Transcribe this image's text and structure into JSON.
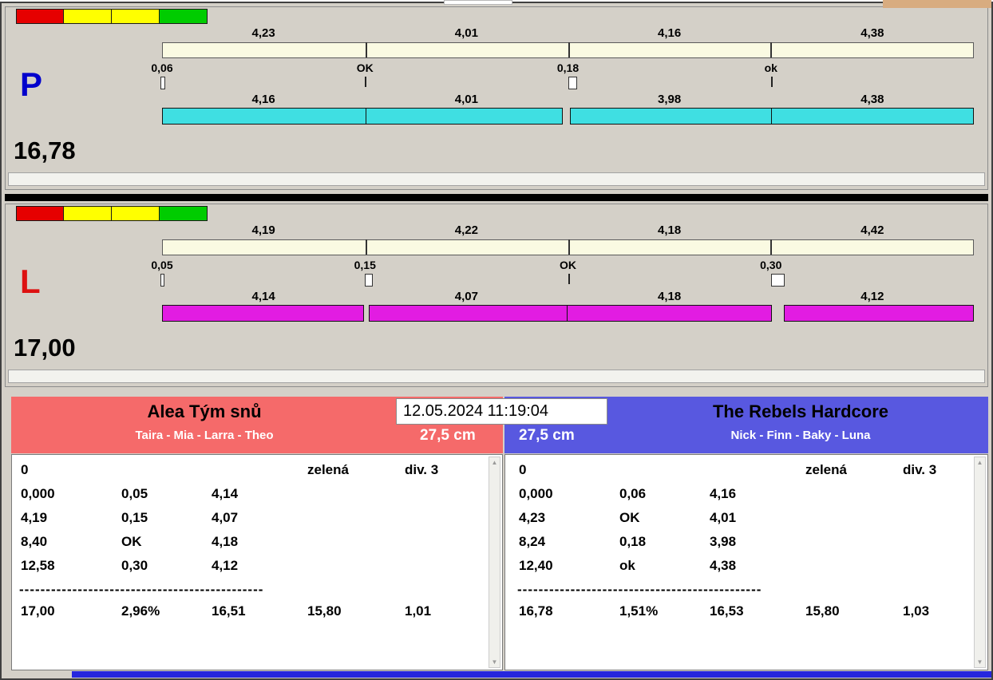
{
  "colors": {
    "window_bg": "#d4d0c8",
    "cream_bar": "#fafae2",
    "cyan_bar": "#3fdfe2",
    "magenta_bar": "#e21ce2",
    "traffic_red": "#e60000",
    "traffic_yellow": "#ffff00",
    "traffic_green": "#00cc00",
    "p_label": "#0000cc",
    "l_label": "#dd1111",
    "team_left_header": "#f56a6a",
    "team_right_header": "#5858e0",
    "bottom_bar": "#2626dd",
    "corner_fragment": "#d8ac80"
  },
  "panel_p": {
    "label": "P",
    "total": "16,78",
    "top_segments": [
      "4,23",
      "4,01",
      "4,16",
      "4,38"
    ],
    "markers": [
      "0,06",
      "OK",
      "0,18",
      "ok"
    ],
    "bottom_segments": [
      "4,16",
      "4,01",
      "3,98",
      "4,38"
    ]
  },
  "panel_l": {
    "label": "L",
    "total": "17,00",
    "top_segments": [
      "4,19",
      "4,22",
      "4,18",
      "4,42"
    ],
    "markers": [
      "0,05",
      "0,15",
      "OK",
      "0,30"
    ],
    "bottom_segments": [
      "4,14",
      "4,07",
      "4,18",
      "4,12"
    ]
  },
  "datetime": "12.05.2024 11:19:04",
  "teams": {
    "left": {
      "name": "Alea Tým snů",
      "members": "Taira - Mia - Larra - Theo",
      "distance": "27,5 cm",
      "rows": [
        [
          "0",
          "",
          "",
          "zelená",
          "div. 3"
        ],
        [
          "0,000",
          "0,05",
          "4,14",
          "",
          ""
        ],
        [
          "4,19",
          "0,15",
          "4,07",
          "",
          ""
        ],
        [
          "8,40",
          "OK",
          "4,18",
          "",
          ""
        ],
        [
          "12,58",
          "0,30",
          "4,12",
          "",
          ""
        ]
      ],
      "separator": "----------------------------------------------",
      "summary": [
        "17,00",
        "2,96%",
        "16,51",
        "15,80",
        "1,01"
      ]
    },
    "right": {
      "name": "The Rebels Hardcore",
      "members": "Nick - Finn - Baky - Luna",
      "distance": "27,5 cm",
      "rows": [
        [
          "0",
          "",
          "",
          "zelená",
          "div. 3"
        ],
        [
          "0,000",
          "0,06",
          "4,16",
          "",
          ""
        ],
        [
          "4,23",
          "OK",
          "4,01",
          "",
          ""
        ],
        [
          "8,24",
          "0,18",
          "3,98",
          "",
          ""
        ],
        [
          "12,40",
          "ok",
          "4,38",
          "",
          ""
        ]
      ],
      "separator": "----------------------------------------------",
      "summary": [
        "16,78",
        "1,51%",
        "16,53",
        "15,80",
        "1,03"
      ]
    }
  }
}
